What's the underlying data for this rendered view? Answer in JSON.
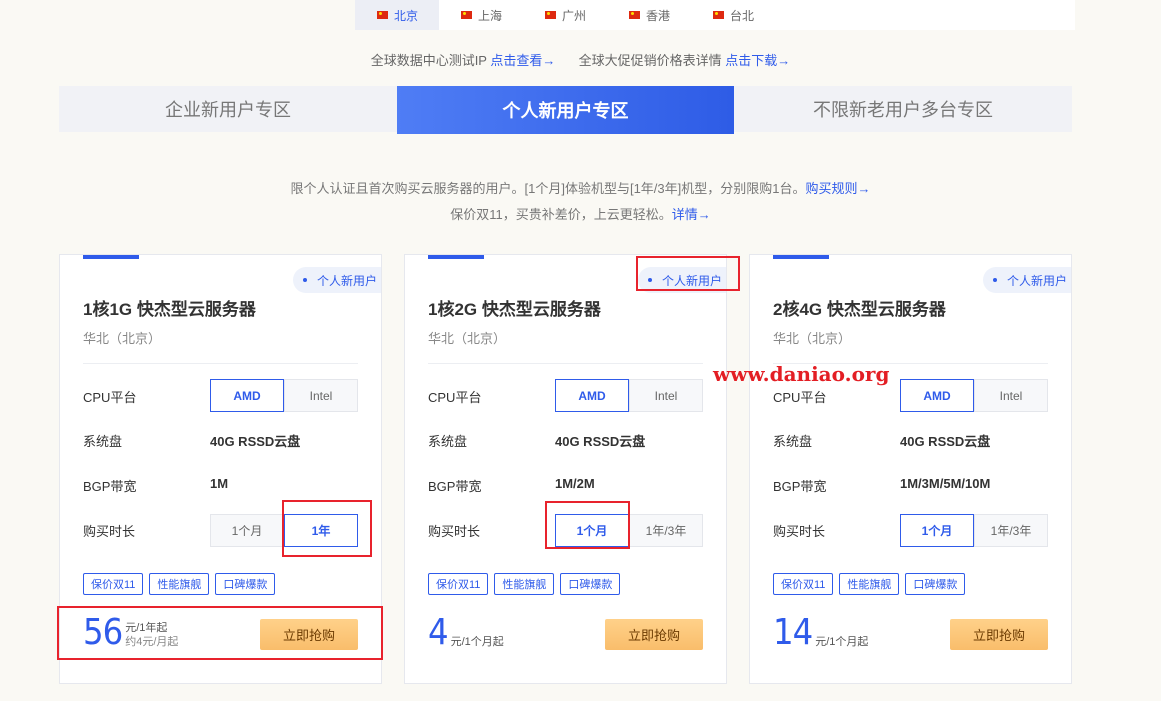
{
  "regions": [
    {
      "label": "北京",
      "active": true
    },
    {
      "label": "上海"
    },
    {
      "label": "广州"
    },
    {
      "label": "香港"
    },
    {
      "label": "台北"
    }
  ],
  "links": {
    "ip_text": "全球数据中心测试IP",
    "ip_link": "点击查看→",
    "price_text": "全球大促促销价格表详情",
    "price_link": "点击下载→"
  },
  "zones": [
    "企业新用户专区",
    "个人新用户专区",
    "不限新老用户多台专区"
  ],
  "notes": {
    "line1": "限个人认证且首次购买云服务器的用户。[1个月]体验机型与[1年/3年]机型，分别限购1台。",
    "line1_link": "购买规则→",
    "line2": "保价双11，买贵补差价，上云更轻松。",
    "line2_link": "详情→"
  },
  "labels": {
    "cpu": "CPU平台",
    "disk": "系统盘",
    "bw": "BGP带宽",
    "duration": "购买时长",
    "buy": "立即抢购"
  },
  "cards": [
    {
      "badge": "个人新用户",
      "title": "1核1G 快杰型云服务器",
      "region": "华北（北京）",
      "cpu_opts": [
        "AMD",
        "Intel"
      ],
      "disk": "40G RSSD云盘",
      "bw": "1M",
      "dur_opts": [
        "1个月",
        "1年"
      ],
      "dur_selected": 1,
      "tags": [
        "保价双11",
        "性能旗舰",
        "口碑爆款"
      ],
      "price": "56",
      "price_unit": "元/1年起",
      "price_sub": "约4元/月起"
    },
    {
      "badge": "个人新用户",
      "title": "1核2G 快杰型云服务器",
      "region": "华北（北京）",
      "cpu_opts": [
        "AMD",
        "Intel"
      ],
      "disk": "40G RSSD云盘",
      "bw": "1M/2M",
      "dur_opts": [
        "1个月",
        "1年/3年"
      ],
      "dur_selected": 0,
      "tags": [
        "保价双11",
        "性能旗舰",
        "口碑爆款"
      ],
      "price": "4",
      "price_unit": "元/1个月起",
      "price_sub": ""
    },
    {
      "badge": "个人新用户",
      "title": "2核4G 快杰型云服务器",
      "region": "华北（北京）",
      "cpu_opts": [
        "AMD",
        "Intel"
      ],
      "disk": "40G RSSD云盘",
      "bw": "1M/3M/5M/10M",
      "dur_opts": [
        "1个月",
        "1年/3年"
      ],
      "dur_selected": 0,
      "tags": [
        "保价双11",
        "性能旗舰",
        "口碑爆款"
      ],
      "price": "14",
      "price_unit": "元/1个月起",
      "price_sub": ""
    }
  ],
  "watermark": "www.daniao.org",
  "colors": {
    "accent": "#2f5bea",
    "highlight": "#e8232d",
    "buy": "#f9bd6b"
  }
}
